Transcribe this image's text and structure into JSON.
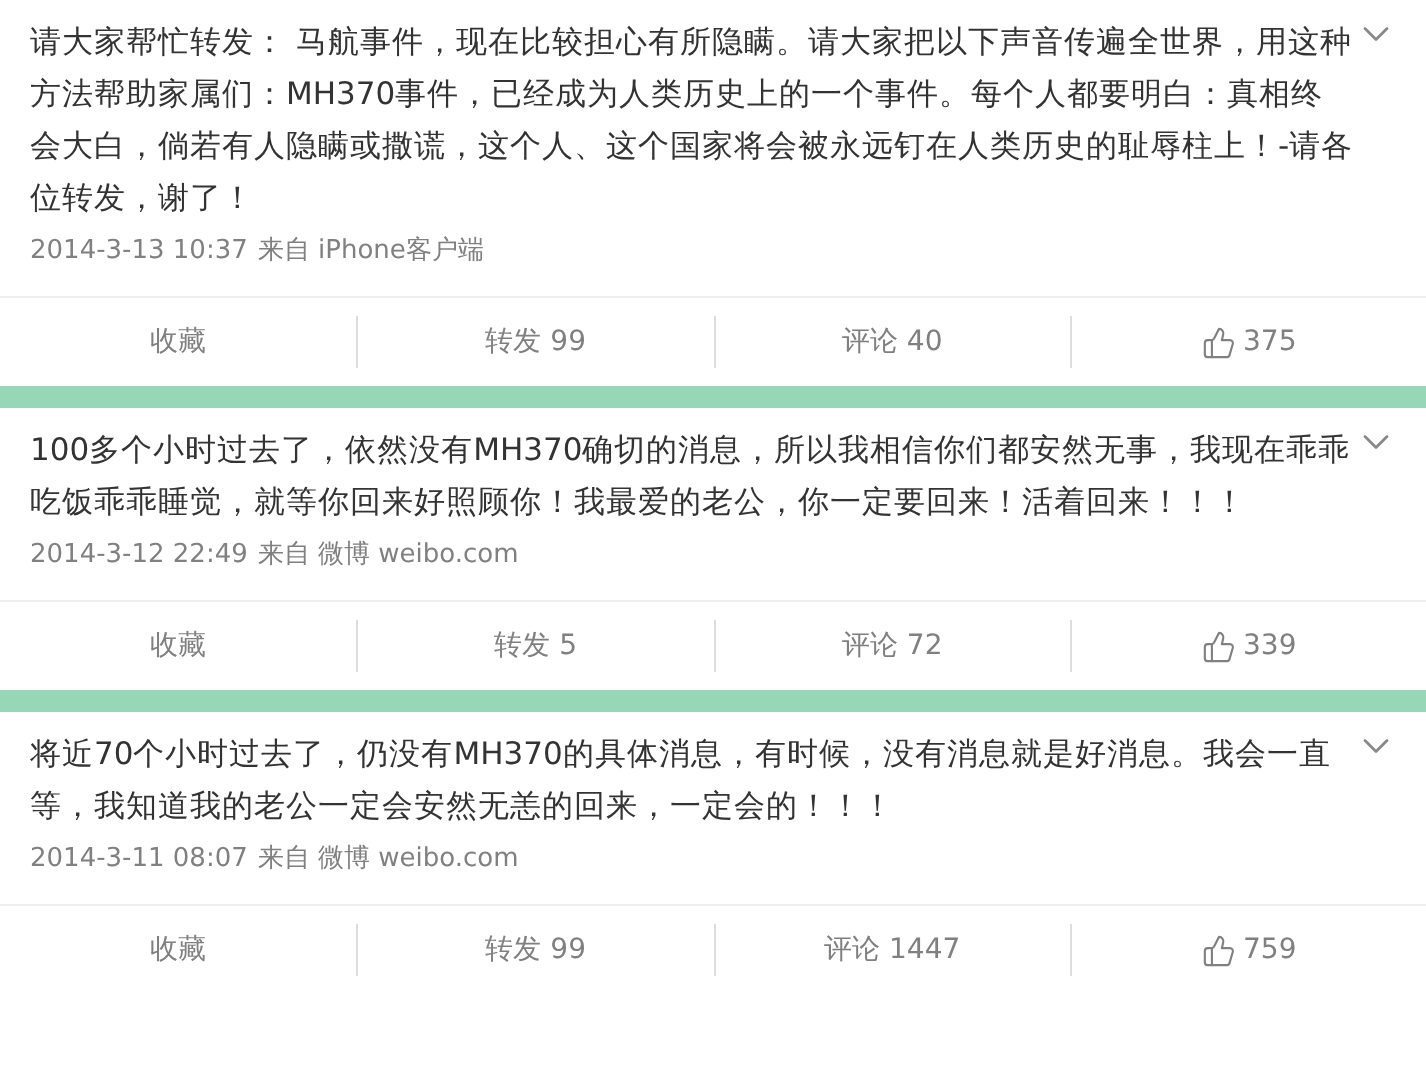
{
  "posts": [
    {
      "text": "请大家帮忙转发： 马航事件，现在比较担心有所隐瞒。请大家把以下声音传遍全世界，用这种方法帮助家属们：MH370事件，已经成为人类历史上的一个事件。每个人都要明白：真相终会大白，倘若有人隐瞒或撒谎，这个人、这个国家将会被永远钉在人类历史的耻辱柱上！-请各位转发，谢了！",
      "time": "2014-3-13 10:37",
      "source": "来自 iPhone客户端",
      "actions": {
        "favorite": "收藏",
        "repost": "转发 99",
        "comment": "评论 40",
        "likes": "375"
      }
    },
    {
      "text": "100多个小时过去了，依然没有MH370确切的消息，所以我相信你们都安然无事，我现在乖乖吃饭乖乖睡觉，就等你回来好照顾你！我最爱的老公，你一定要回来！活着回来！！！",
      "time": "2014-3-12 22:49",
      "source": "来自 微博 weibo.com",
      "actions": {
        "favorite": "收藏",
        "repost": "转发 5",
        "comment": "评论 72",
        "likes": "339"
      }
    },
    {
      "text": "将近70个小时过去了，仍没有MH370的具体消息，有时候，没有消息就是好消息。我会一直等，我知道我的老公一定会安然无恙的回来，一定会的！！！",
      "time": "2014-3-11 08:07",
      "source": "来自 微博 weibo.com",
      "actions": {
        "favorite": "收藏",
        "repost": "转发 99",
        "comment": "评论 1447",
        "likes": "759"
      }
    }
  ]
}
